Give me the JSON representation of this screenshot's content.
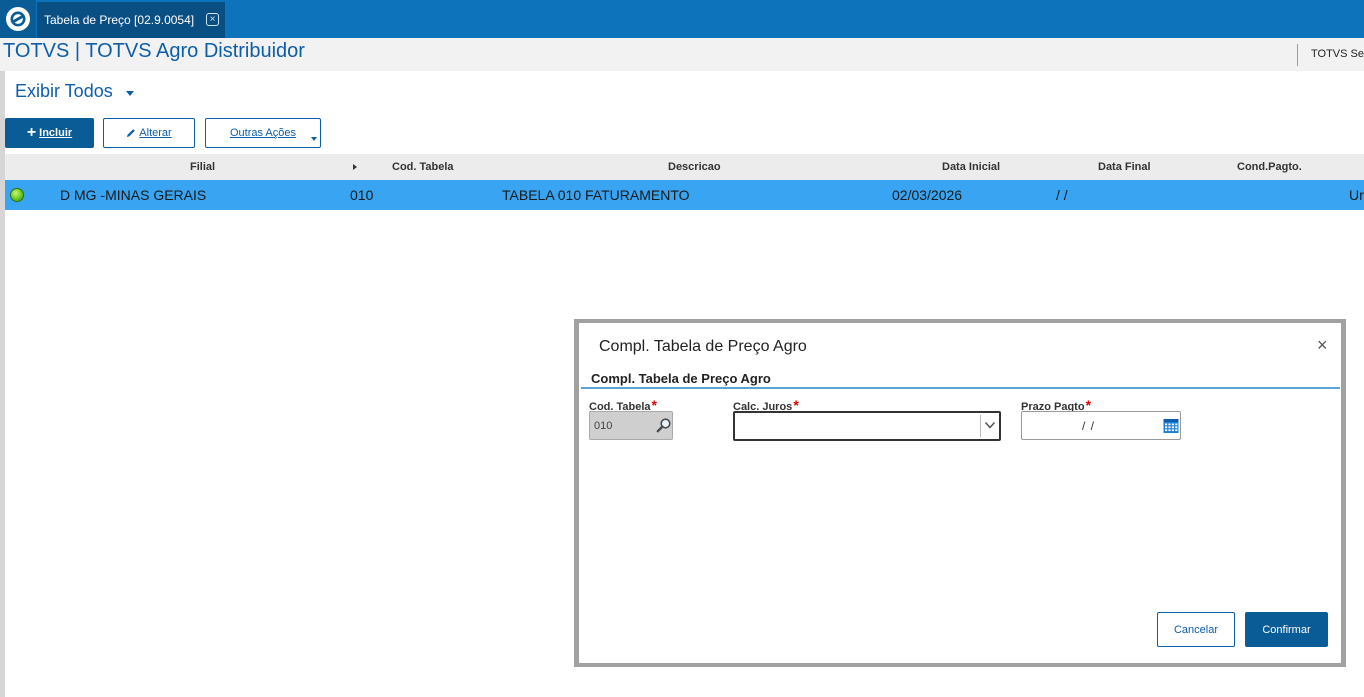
{
  "tabbar": {
    "tab_label": "Tabela de Preço [02.9.0054]",
    "tab_close": "×"
  },
  "header": {
    "title": "TOTVS | TOTVS Agro Distribuidor",
    "user_text": "TOTVS Se"
  },
  "browse": {
    "view_filter": "Exibir Todos",
    "buttons": {
      "incluir": "Incluir",
      "alterar": "Alterar",
      "outras": "Outras Ações"
    },
    "columns": {
      "filial": "Filial",
      "cod_tabela": "Cod. Tabela",
      "descricao": "Descricao",
      "data_inicial": "Data Inicial",
      "data_final": "Data Final",
      "cond_pagto": "Cond.Pagto."
    },
    "rows": [
      {
        "filial": "D MG -MINAS GERAIS",
        "cod_tabela": "010",
        "descricao": "TABELA 010 FATURAMENTO",
        "data_inicial": "02/03/2026",
        "data_final": "/ /",
        "extra": "Ur"
      }
    ]
  },
  "dialog": {
    "title": "Compl. Tabela de Preço Agro",
    "close": "×",
    "section": "Compl. Tabela de Preço Agro",
    "fields": {
      "cod_tabela": {
        "label": "Cod. Tabela",
        "required": "*",
        "value": "010"
      },
      "calc_juros": {
        "label": "Calc. Juros",
        "required": "*",
        "value": ""
      },
      "prazo_pagto": {
        "label": "Prazo Pagto",
        "required": "*",
        "value": "/ /"
      }
    },
    "buttons": {
      "cancel": "Cancelar",
      "confirm": "Confirmar"
    }
  },
  "colors": {
    "tabbar": "#0d73ba",
    "primary_button": "#0a5c97",
    "selected_row": "#38a4f2",
    "title_text": "#0d5ea8",
    "required": "#e00000"
  }
}
